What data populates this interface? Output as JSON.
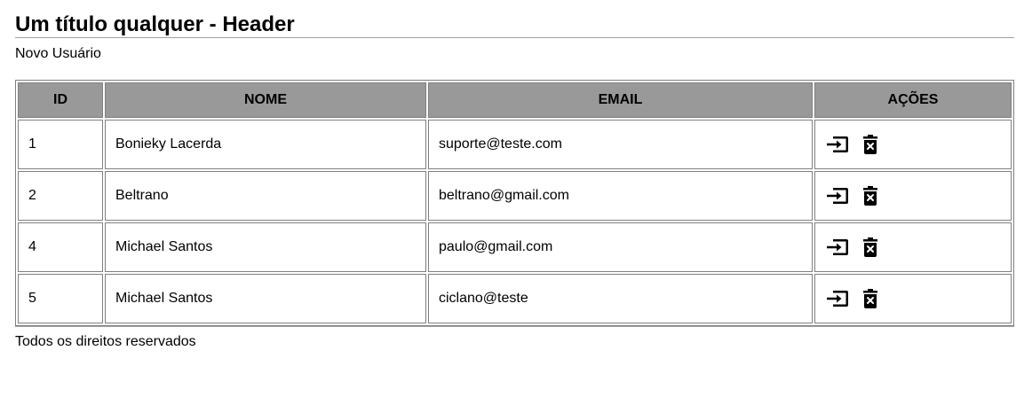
{
  "header": {
    "title": "Um título qualquer - Header"
  },
  "nav": {
    "new_user_label": "Novo Usuário"
  },
  "table": {
    "columns": [
      "ID",
      "NOME",
      "EMAIL",
      "AÇÕES"
    ],
    "rows": [
      {
        "id": "1",
        "name": "Bonieky Lacerda",
        "email": "suporte@teste.com",
        "actions": [
          "edit-icon",
          "delete-icon"
        ]
      },
      {
        "id": "2",
        "name": "Beltrano",
        "email": "beltrano@gmail.com",
        "actions": [
          "edit-icon",
          "delete-icon"
        ]
      },
      {
        "id": "4",
        "name": "Michael Santos",
        "email": "paulo@gmail.com",
        "actions": [
          "edit-icon",
          "delete-icon"
        ]
      },
      {
        "id": "5",
        "name": "Michael Santos",
        "email": "ciclano@teste",
        "actions": [
          "edit-icon",
          "delete-icon"
        ]
      }
    ]
  },
  "footer": {
    "text": "Todos os direitos reservados"
  },
  "colors": {
    "header_background": "#999999",
    "border": "#808080",
    "rule": "#a0a0a0"
  }
}
